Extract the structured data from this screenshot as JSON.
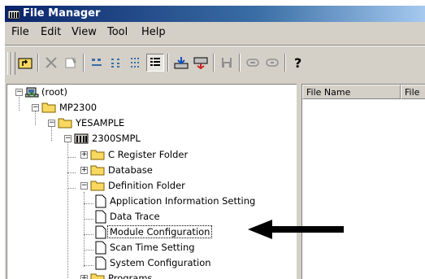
{
  "window": {
    "title": "File Manager",
    "app_icon": "file-manager-icon"
  },
  "menu": [
    "File",
    "Edit",
    "View",
    "Tool",
    "Help"
  ],
  "toolbar": {
    "buttons": [
      "up-folder-icon",
      "delete-icon",
      "properties-icon",
      "small-icons-view-icon",
      "list-view-icon",
      "details-view-icon",
      "large-details-view-icon",
      "download-icon",
      "upload-icon",
      "save-icon",
      "link-icon",
      "unlink-icon",
      "help-icon"
    ]
  },
  "tree": {
    "root": "(root)",
    "mp": "MP2300",
    "yesample": "YESAMPLE",
    "smpl": "2300SMPL",
    "cregister": "C Register Folder",
    "database": "Database",
    "definition": "Definition Folder",
    "app_info": "Application Information Setting",
    "data_trace": "Data Trace",
    "module_config": "Module Configuration",
    "scan_time": "Scan Time Setting",
    "system_config": "System Configuration",
    "programs": "Programs"
  },
  "list": {
    "columns": [
      "File Name",
      "File"
    ]
  },
  "colors": {
    "folder": "#f8d860",
    "selection_arrow": "#000000",
    "titlebar": "#0a246a"
  }
}
